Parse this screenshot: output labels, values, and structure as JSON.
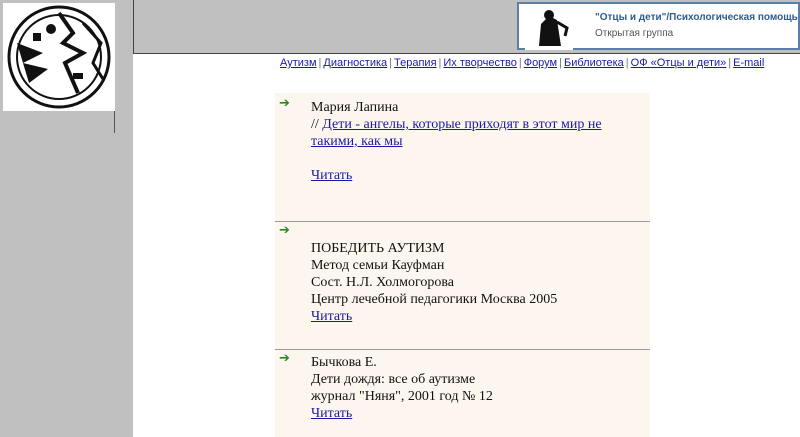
{
  "group": {
    "title": "\"Отцы и дети\"/Психологическая помощь",
    "subtitle": "Открытая группа"
  },
  "nav": {
    "items": [
      {
        "label": "Аутизм"
      },
      {
        "label": "Диагностика"
      },
      {
        "label": "Терапия"
      },
      {
        "label": "Их творчество"
      },
      {
        "label": "Форум"
      },
      {
        "label": "Библиотека"
      },
      {
        "label": "ОФ «Отцы и дети»"
      },
      {
        "label": "E-mail"
      }
    ]
  },
  "articles": [
    {
      "author": "Мария Лапина",
      "prefix": "// ",
      "title_link": "Дети - ангелы, которые приходят в этот мир не такими, как мы",
      "read": "Читать"
    },
    {
      "lines": [
        "ПОБЕДИТЬ АУТИЗМ",
        "Метод семьи Кауфман",
        "Сост. Н.Л. Холмогорова",
        "Центр лечебной педагогики Москва 2005"
      ],
      "read": "Читать"
    },
    {
      "lines": [
        "Бычкова Е.",
        "Дети дождя: все об аутизме",
        "журнал \"Няня\", 2001 год № 12"
      ],
      "read": "Читать"
    }
  ],
  "colors": {
    "accent_arrow": "#2a8a1f",
    "link": "#1a1aa6",
    "sidebar": "#c0c0c0",
    "content_bg": "#fdf6ee"
  }
}
